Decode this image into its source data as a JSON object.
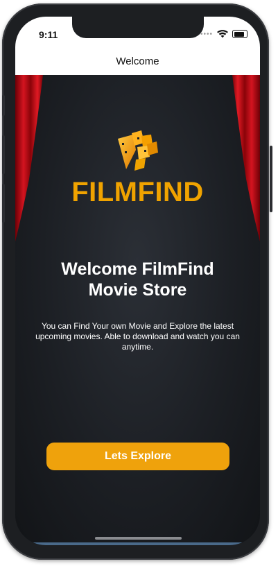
{
  "status_bar": {
    "time": "9:11",
    "signal_icon": "signal-dots-icon",
    "wifi_icon": "wifi-icon",
    "battery_icon": "battery-icon"
  },
  "nav": {
    "title": "Welcome"
  },
  "brand": {
    "name": "FILMFIND",
    "logo_icon": "film-reel-logo-icon",
    "accent_color": "#f0a300"
  },
  "welcome": {
    "headline_line1": "Welcome FilmFind",
    "headline_line2": "Movie Store",
    "description": "You can Find Your own Movie and Explore the latest upcoming movies. Able to download and watch you can anytime."
  },
  "cta": {
    "label": "Lets Explore",
    "color": "#efa20c"
  },
  "decor": {
    "curtain_color": "#c4121a",
    "background_color": "#1c1f24"
  }
}
